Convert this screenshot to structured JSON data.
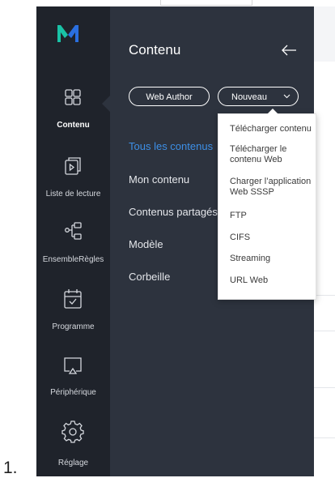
{
  "list_marker": "1.",
  "colors": {
    "sidebar_bg": "#1f232b",
    "panel_bg": "#2d333e",
    "accent_blue": "#3d8fe6",
    "logo_green": "#19c2a6",
    "logo_blue": "#2a6fe0"
  },
  "sidebar": {
    "items": [
      {
        "label": "Contenu",
        "icon": "grid-icon",
        "active": true
      },
      {
        "label": "Liste de lecture",
        "icon": "playlist-icon",
        "active": false
      },
      {
        "label": "EnsembleRègles",
        "icon": "rules-tree-icon",
        "active": false
      },
      {
        "label": "Programme",
        "icon": "calendar-icon",
        "active": false
      },
      {
        "label": "Périphérique",
        "icon": "display-device-icon",
        "active": false
      },
      {
        "label": "Réglage",
        "icon": "gear-icon",
        "active": false
      }
    ]
  },
  "panel": {
    "title": "Contenu",
    "buttons": {
      "web_author": "Web Author",
      "nouveau": "Nouveau"
    },
    "categories": [
      {
        "label": "Tous les contenus",
        "active": true
      },
      {
        "label": "Mon contenu",
        "active": false
      },
      {
        "label": "Contenus partagés",
        "active": false
      },
      {
        "label": "Modèle",
        "active": false
      },
      {
        "label": "Corbeille",
        "active": false
      }
    ]
  },
  "dropdown": {
    "items": [
      {
        "label": "Télécharger contenu"
      },
      {
        "label": "Télécharger le contenu Web"
      },
      {
        "label": "Charger l’application Web SSSP"
      },
      {
        "label": "FTP"
      },
      {
        "label": "CIFS"
      },
      {
        "label": "Streaming"
      },
      {
        "label": "URL Web"
      }
    ]
  }
}
